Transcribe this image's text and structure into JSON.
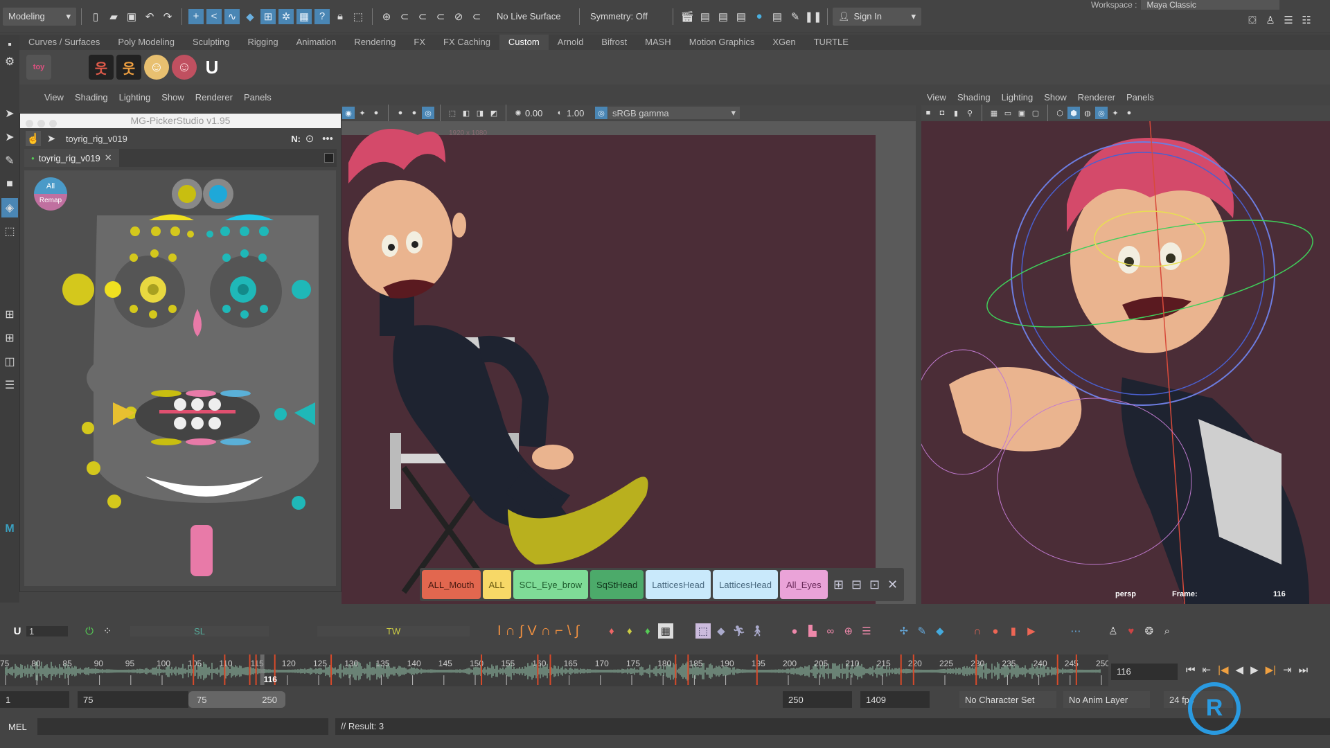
{
  "statusline": {
    "mode_menu": "Modeling",
    "live_surface": "No Live Surface",
    "symmetry": "Symmetry: Off",
    "sign_in": "Sign In",
    "workspace_label": "Workspace :",
    "workspace_value": "Maya Classic"
  },
  "shelf": {
    "tabs": [
      "Curves / Surfaces",
      "Poly Modeling",
      "Sculpting",
      "Rigging",
      "Animation",
      "Rendering",
      "FX",
      "FX Caching",
      "Custom",
      "Arnold",
      "Bifrost",
      "MASH",
      "Motion Graphics",
      "XGen",
      "TURTLE"
    ],
    "active_tab": "Custom",
    "icons": [
      "toy-icon",
      "character-red-icon",
      "character-orange-icon",
      "girl-avatar-icon",
      "boy-avatar-icon",
      "magnet-u-icon"
    ]
  },
  "viewport_left": {
    "menus": [
      "View",
      "Shading",
      "Lighting",
      "Show",
      "Renderer",
      "Panels"
    ],
    "exposure": "0.00",
    "gamma": "1.00",
    "color_space": "sRGB gamma",
    "resolution": "1920 x 1080"
  },
  "viewport_right": {
    "menus": [
      "View",
      "Shading",
      "Lighting",
      "Show",
      "Renderer",
      "Panels"
    ],
    "camera": "persp",
    "frame_label": "Frame:",
    "frame_value": "116"
  },
  "picker": {
    "title": "MG-PickerStudio v1.95",
    "character": "toyrig_rig_v019",
    "tab": "toyrig_rig_v019",
    "n_label": "N:",
    "all_label": "All",
    "remap_label": "Remap"
  },
  "selection_sets": [
    {
      "label": "ALL_Mouth",
      "color": "#e2674f",
      "text": "#4a1a10"
    },
    {
      "label": "ALL",
      "color": "#f7d867",
      "text": "#6b5a10"
    },
    {
      "label": "SCL_Eye_brow",
      "color": "#7fdc97",
      "text": "#1d5a2c"
    },
    {
      "label": "SqStHead",
      "color": "#4caa6a",
      "text": "#10361c"
    },
    {
      "label": "LatticesHead",
      "color": "#c9e9fb",
      "text": "#4a6a80"
    },
    {
      "label": "LatticesHead",
      "color": "#c9e9fb",
      "text": "#4a6a80"
    },
    {
      "label": "All_Eyes",
      "color": "#eaa3d8",
      "text": "#6a2a5a"
    }
  ],
  "bottom_toolbar": {
    "frame_field": "1",
    "sl_label": "SL",
    "tw_label": "TW"
  },
  "timeline": {
    "start": 75,
    "end": 250,
    "step": 5,
    "current_frame": 116,
    "current_frame_field": "116",
    "keys": [
      105,
      110,
      114,
      115,
      118,
      127,
      151,
      160,
      162,
      182,
      184,
      195,
      218,
      220,
      230,
      243,
      246
    ]
  },
  "range": {
    "start": "1",
    "playback_start": "75",
    "slider_start": "75",
    "slider_end": "250",
    "playback_end": "250",
    "end": "1409",
    "character_set": "No Character Set",
    "anim_layer": "No Anim Layer",
    "fps": "24 fps"
  },
  "command": {
    "language": "MEL",
    "result": "// Result: 3"
  },
  "colors": {
    "accent": "#4a86b4",
    "viewport_bg": "#4b2d37",
    "picker_yellow": "#d4c81c",
    "picker_cyan": "#1fb8b8"
  }
}
